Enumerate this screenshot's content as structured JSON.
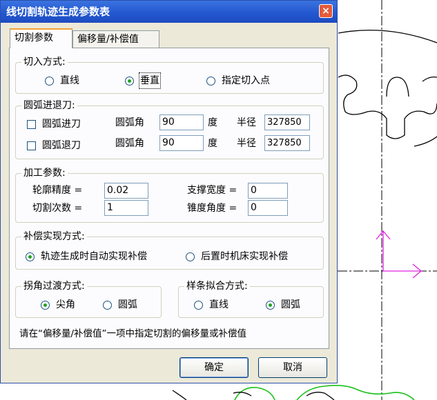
{
  "window": {
    "title": "线切割轨迹生成参数表",
    "close_label": "×"
  },
  "tabs": [
    {
      "label": "切割参数",
      "active": true
    },
    {
      "label": "偏移量/补偿值",
      "active": false
    }
  ],
  "entry_mode": {
    "legend": "切入方式:",
    "options": [
      {
        "label": "直线",
        "selected": false
      },
      {
        "label": "垂直",
        "selected": true
      },
      {
        "label": "指定切入点",
        "selected": false
      }
    ]
  },
  "arc_feed": {
    "legend": "圆弧进退刀:",
    "rows": [
      {
        "label": "圆弧进刀",
        "checked": false,
        "angle_label": "圆弧角",
        "angle_value": "90",
        "unit": "度",
        "radius_label": "半径",
        "radius_value": "327850"
      },
      {
        "label": "圆弧退刀",
        "checked": false,
        "angle_label": "圆弧角",
        "angle_value": "90",
        "unit": "度",
        "radius_label": "半径",
        "radius_value": "327850"
      }
    ]
  },
  "machining": {
    "legend": "加工参数:",
    "precision_label": "轮廓精度 =",
    "precision_value": "0.02",
    "passes_label": "切割次数 =",
    "passes_value": "1",
    "support_label": "支撑宽度 =",
    "support_value": "0",
    "taper_label": "锥度角度 =",
    "taper_value": "0"
  },
  "compensation": {
    "legend": "补偿实现方式:",
    "options": [
      {
        "label": "轨迹生成时自动实现补偿",
        "selected": true
      },
      {
        "label": "后置时机床实现补偿",
        "selected": false
      }
    ]
  },
  "corner": {
    "legend": "拐角过渡方式:",
    "options": [
      {
        "label": "尖角",
        "selected": true
      },
      {
        "label": "圆弧",
        "selected": false
      }
    ]
  },
  "spline": {
    "legend": "样条拟合方式:",
    "options": [
      {
        "label": "直线",
        "selected": false
      },
      {
        "label": "圆弧",
        "selected": true
      }
    ]
  },
  "hint": "请在“偏移量/补偿值”一项中指定切割的偏移量或补偿值",
  "buttons": {
    "ok": "确定",
    "cancel": "取消"
  },
  "colors": {
    "title_bar": "#2458d0",
    "dialog_face": "#ece9d8",
    "axis_marker": "#e020e0",
    "curve_green": "#18c018"
  }
}
